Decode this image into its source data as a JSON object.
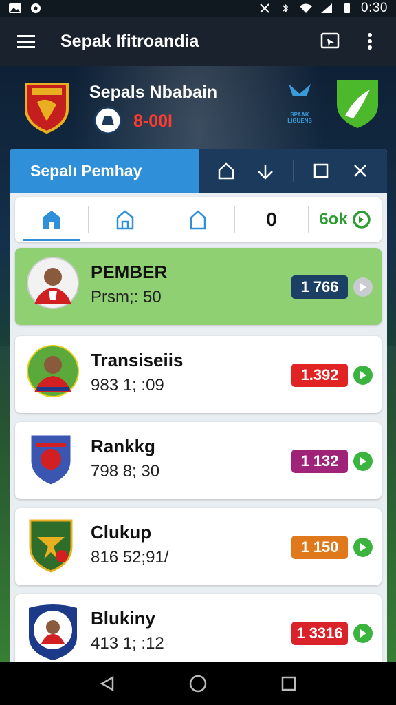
{
  "status_bar": {
    "time": "0:30"
  },
  "app_bar": {
    "title": "Sepak Ifitroandia"
  },
  "match": {
    "title": "Sepals Nbabain",
    "score": "8-00I",
    "sponsor_text": "SPAAK LIGUENS"
  },
  "panel": {
    "title": "Sepalı Pemhay",
    "tabs": [
      {
        "kind": "home-icon",
        "active": true
      },
      {
        "kind": "outline-home-icon"
      },
      {
        "kind": "outline-house-icon"
      },
      {
        "label": "0"
      },
      {
        "label": "6ok"
      }
    ]
  },
  "cards": [
    {
      "name": "PEMBER",
      "sub": "Prsm;: 50",
      "badge": "1 766",
      "badge_color": "#1c3f66",
      "go_color": "#c8ccd0",
      "highlight": true,
      "avatar": "player-red"
    },
    {
      "name": "Transiseiis",
      "sub": "983 1; :09",
      "badge": "1.392",
      "badge_color": "#e02424",
      "go_color": "#3ab43e",
      "avatar": "player-green"
    },
    {
      "name": "Rankkg",
      "sub": "798 8; 30",
      "badge": "1 132",
      "badge_color": "#a0237a",
      "go_color": "#3ab43e",
      "avatar": "crest-blue-red"
    },
    {
      "name": "Clukup",
      "sub": "816 52;91/",
      "badge": "1 150",
      "badge_color": "#e0791c",
      "go_color": "#3ab43e",
      "avatar": "crest-green"
    },
    {
      "name": "Blukiny",
      "sub": "413 1; :12",
      "badge": "1 3316",
      "badge_color": "#d9222a",
      "go_color": "#3ab43e",
      "avatar": "player-blue"
    }
  ],
  "colors": {
    "accent": "#2f8fd8",
    "appbar": "#1a222d",
    "green": "#3ab43e"
  }
}
